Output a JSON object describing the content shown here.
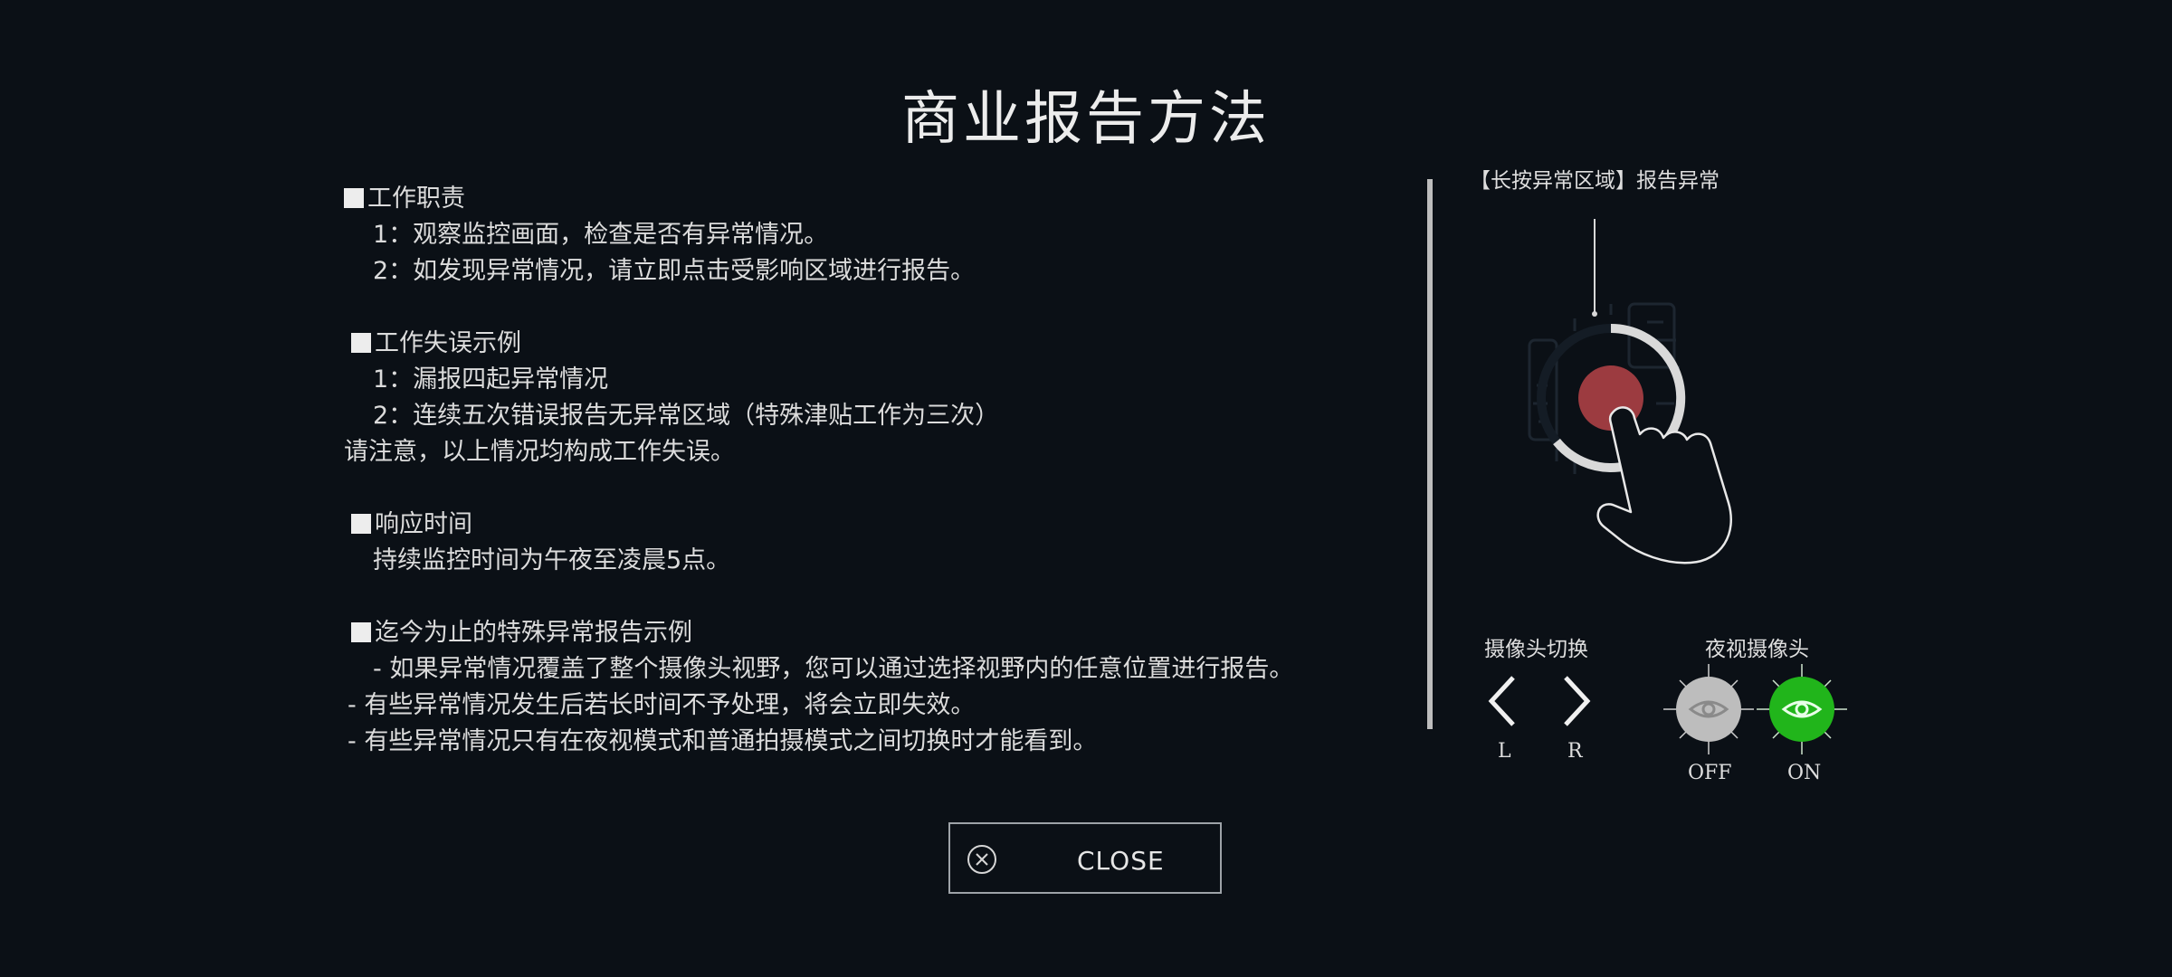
{
  "title": "商业报告方法",
  "sections": {
    "duties": {
      "heading": "工作职责",
      "items": [
        "1：观察监控画面，检查是否有异常情况。",
        "2：如发现异常情况，请立即点击受影响区域进行报告。"
      ]
    },
    "errors": {
      "heading": "工作失误示例",
      "items": [
        "1：漏报四起异常情况",
        "2：连续五次错误报告无异常区域（特殊津贴工作为三次）"
      ],
      "note": "请注意，以上情况均构成工作失误。"
    },
    "response": {
      "heading": "响应时间",
      "items": [
        "持续监控时间为午夜至凌晨5点。"
      ]
    },
    "special": {
      "heading": "迄今为止的特殊异常报告示例",
      "items": [
        "- 如果异常情况覆盖了整个摄像头视野，您可以通过选择视野内的任意位置进行报告。",
        "- 有些异常情况发生后若长时间不予处理，将会立即失效。",
        "- 有些异常情况只有在夜视模式和普通拍摄模式之间切换时才能看到。"
      ]
    }
  },
  "side_panel": {
    "hint": "【长按异常区域】报告异常",
    "camera_switch": {
      "label": "摄像头切换",
      "left": "L",
      "right": "R"
    },
    "night_vision": {
      "label": "夜视摄像头",
      "off": "OFF",
      "on": "ON"
    }
  },
  "close_button": {
    "label": "CLOSE"
  },
  "colors": {
    "background": "#0b1016",
    "record_red": "#9c3b40",
    "night_on_green": "#21b51b",
    "night_off_gray": "#bfbfbf"
  },
  "icons": {
    "hand": "pointing-hand-icon",
    "record": "record-button-icon",
    "close": "circle-x-icon",
    "eye": "eye-icon"
  }
}
